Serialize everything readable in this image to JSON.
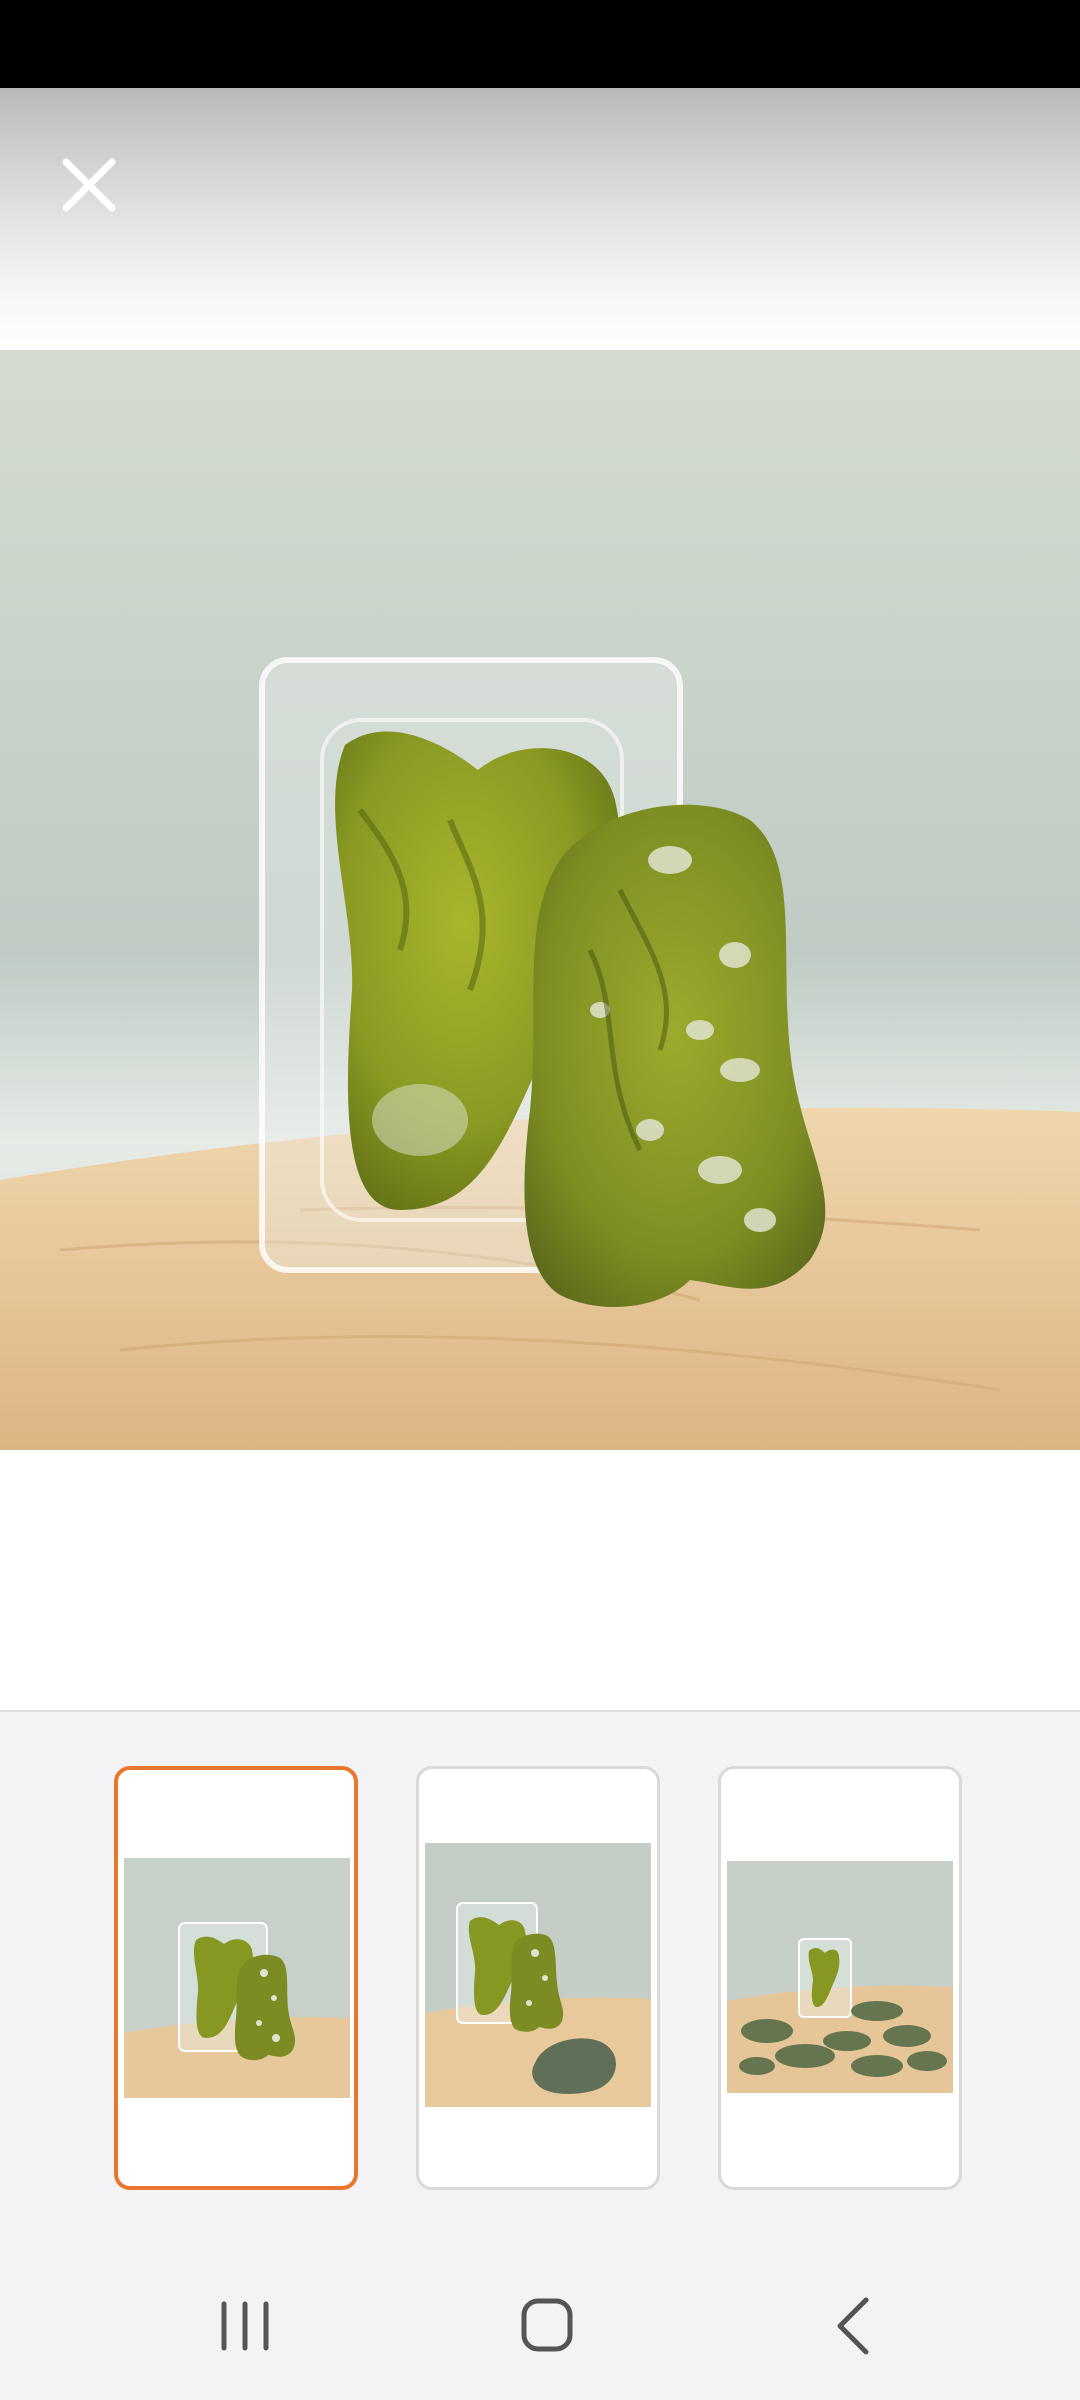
{
  "colors": {
    "accent": "#e8772e",
    "status_bar": "#000000",
    "thumb_strip_bg": "#f3f3f5",
    "jade": "#8a9a22",
    "wood": "#e9c99a"
  },
  "viewer": {
    "close_icon": "close-icon",
    "selected_index": 0
  },
  "thumbnails": [
    {
      "icon": "thumbnail-1",
      "selected": true
    },
    {
      "icon": "thumbnail-2",
      "selected": false
    },
    {
      "icon": "thumbnail-3",
      "selected": false
    }
  ],
  "nav": {
    "recents_icon": "recent-apps-icon",
    "home_icon": "home-icon",
    "back_icon": "back-icon"
  }
}
